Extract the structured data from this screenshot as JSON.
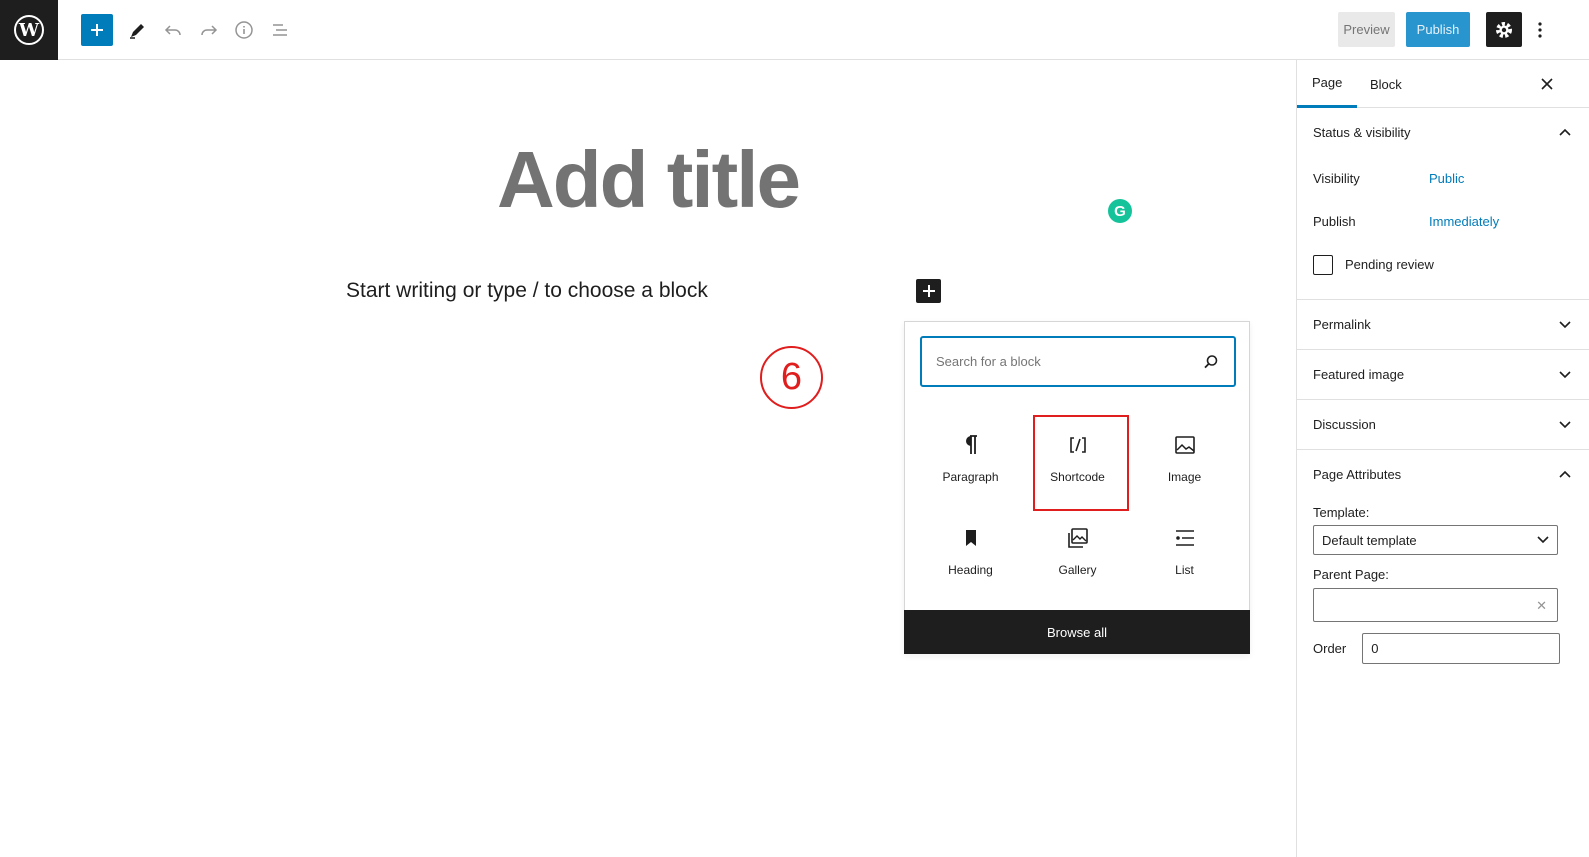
{
  "toolbar": {
    "preview_label": "Preview",
    "publish_label": "Publish",
    "icons": [
      "wordpress-logo",
      "plus",
      "pencil",
      "undo",
      "redo",
      "info",
      "list-view",
      "gear",
      "more-vertical"
    ]
  },
  "editor": {
    "title_placeholder": "Add title",
    "paragraph_placeholder": "Start writing or type / to choose a block",
    "step_number": "6"
  },
  "inserter": {
    "search_placeholder": "Search for a block",
    "blocks": [
      {
        "label": "Paragraph",
        "icon": "pilcrow"
      },
      {
        "label": "Shortcode",
        "icon": "shortcode"
      },
      {
        "label": "Image",
        "icon": "image"
      },
      {
        "label": "Heading",
        "icon": "bookmark"
      },
      {
        "label": "Gallery",
        "icon": "gallery"
      },
      {
        "label": "List",
        "icon": "list"
      }
    ],
    "highlighted_block": "Shortcode",
    "browse_all_label": "Browse all"
  },
  "sidebar": {
    "tabs": [
      "Page",
      "Block"
    ],
    "active_tab": "Page",
    "status_panel": {
      "title": "Status & visibility",
      "visibility_label": "Visibility",
      "visibility_value": "Public",
      "publish_label": "Publish",
      "publish_value": "Immediately",
      "pending_label": "Pending review"
    },
    "panels": [
      "Permalink",
      "Featured image",
      "Discussion"
    ],
    "page_attributes": {
      "title": "Page Attributes",
      "template_label": "Template:",
      "template_value": "Default template",
      "parent_label": "Parent Page:",
      "parent_value": "",
      "order_label": "Order",
      "order_value": "0"
    }
  },
  "colors": {
    "accent": "#007cba",
    "dark": "#1e1e1e",
    "annotation_red": "#e01e1e",
    "grammarly": "#15c39a"
  }
}
